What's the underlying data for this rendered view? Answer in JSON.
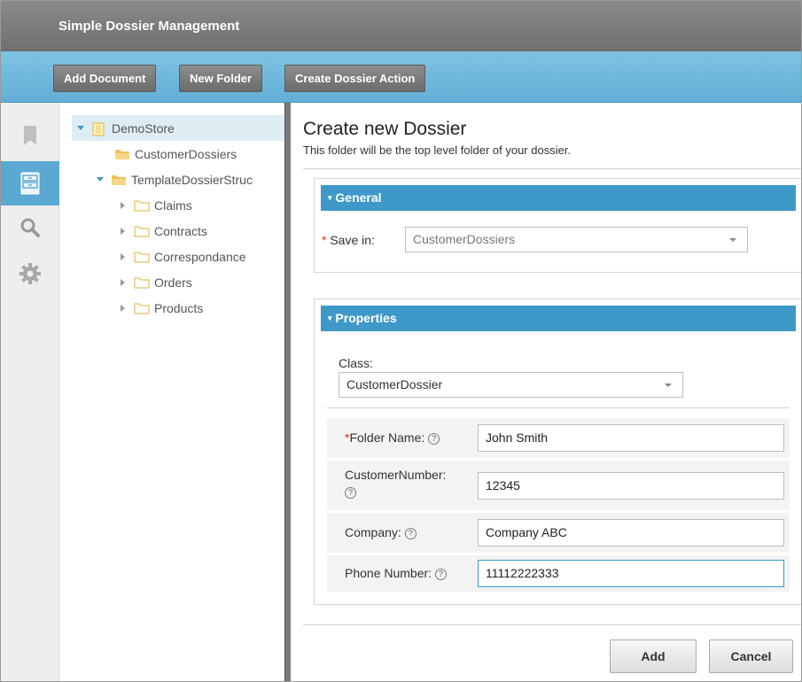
{
  "app": {
    "title": "Simple Dossier Management"
  },
  "toolbar": {
    "add_document": "Add Document",
    "new_folder": "New Folder",
    "create_dossier_action": "Create Dossier Action"
  },
  "rail": {
    "icons": [
      "bookmark-icon",
      "cabinet-icon",
      "search-icon",
      "gear-icon"
    ],
    "active": "cabinet-icon"
  },
  "tree": {
    "root": "DemoStore",
    "items": [
      {
        "label": "CustomerDossiers"
      },
      {
        "label": "TemplateDossierStruc"
      },
      {
        "label": "Claims"
      },
      {
        "label": "Contracts"
      },
      {
        "label": "Correspondance"
      },
      {
        "label": "Orders"
      },
      {
        "label": "Products"
      }
    ]
  },
  "main": {
    "title": "Create new Dossier",
    "subtitle": "This folder will be the top level folder of your dossier."
  },
  "general": {
    "header": "General",
    "save_in_required": "*",
    "save_in_label": "Save in:",
    "save_in_value": "CustomerDossiers"
  },
  "properties": {
    "header": "Properties",
    "class_label": "Class:",
    "class_value": "CustomerDossier",
    "fields": [
      {
        "required": "*",
        "label": "Folder Name:",
        "value": "John Smith"
      },
      {
        "label": "CustomerNumber:",
        "value": "12345"
      },
      {
        "label": "Company:",
        "value": "Company ABC"
      },
      {
        "label": "Phone Number:",
        "value": "11112222333"
      }
    ],
    "help_glyph": "?"
  },
  "actions": {
    "add": "Add",
    "cancel": "Cancel"
  },
  "colors": {
    "title_bar": "#7d7d7d",
    "toolbar": "#6db8dd",
    "section_header": "#3f99c8",
    "required": "#d9301c",
    "tree_selected": "#deedf4"
  }
}
